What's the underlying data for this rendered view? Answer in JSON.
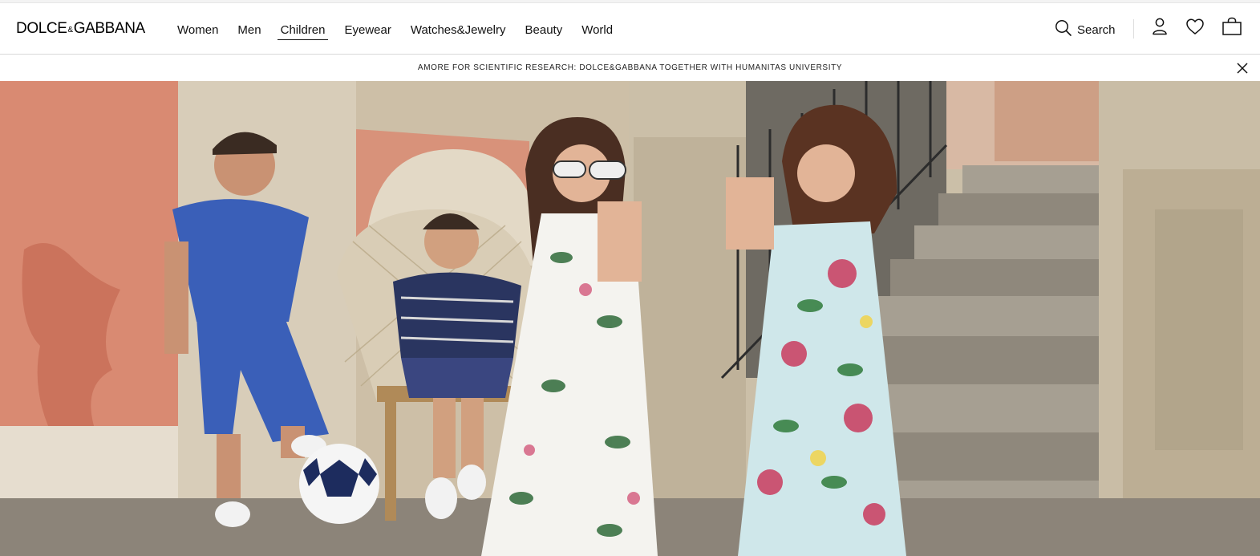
{
  "brand": {
    "name_left": "DOLCE",
    "ampersand": "&",
    "name_right": "GABBANA"
  },
  "nav": {
    "items": [
      {
        "label": "Women",
        "active": false
      },
      {
        "label": "Men",
        "active": false
      },
      {
        "label": "Children",
        "active": true
      },
      {
        "label": "Eyewear",
        "active": false
      },
      {
        "label": "Watches&Jewelry",
        "active": false
      },
      {
        "label": "Beauty",
        "active": false
      },
      {
        "label": "World",
        "active": false
      }
    ]
  },
  "tools": {
    "search_label": "Search",
    "icons": [
      "search-icon",
      "account-icon",
      "wishlist-heart-icon",
      "shopping-bag-icon"
    ]
  },
  "announcement": {
    "text": "AMORE FOR SCIENTIFIC RESEARCH: DOLCE&GABBANA TOGETHER WITH HUMANITAS UNIVERSITY",
    "close_icon": "close-icon"
  },
  "hero": {
    "image_subject": "children-campaign-photo",
    "colors": {
      "wall_pink": "#d98a72",
      "stone": "#cfc3ad",
      "steps": "#9a9488",
      "ground": "#8c8479"
    }
  }
}
